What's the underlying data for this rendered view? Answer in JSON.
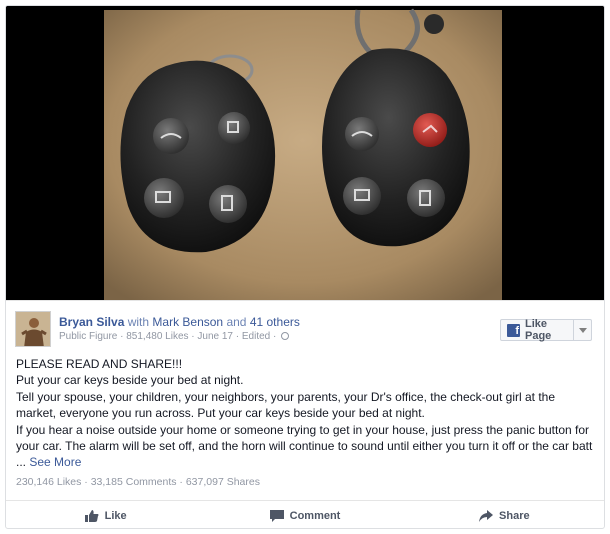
{
  "post": {
    "author": "Bryan Silva",
    "with_text": "with",
    "tagged": "Mark Benson",
    "and_text": "and",
    "others": "41 others",
    "meta": "Public Figure · 851,480 Likes · June 17 · Edited ·",
    "like_page_label": "Like Page",
    "lines": [
      "PLEASE READ AND SHARE!!!",
      "Put your car keys beside your bed at night.",
      "Tell your spouse, your children, your neighbors, your parents, your Dr's office, the check-out girl at the",
      "market, everyone you run across. Put your car keys beside your bed at night.",
      "If you hear a noise outside your home or someone trying to get in your house, just press the panic button for",
      "your car. The alarm will be set off, and the horn will continue to sound until either you turn it off or the car batt"
    ],
    "ellipsis": "...",
    "see_more": "See More",
    "stats": "230,146 Likes · 33,185 Comments · 637,097 Shares"
  },
  "actions": {
    "like": "Like",
    "comment": "Comment",
    "share": "Share"
  },
  "icons": {
    "photo": "car-key-fobs-photo",
    "like": "thumbs-up-icon",
    "comment": "comment-icon",
    "share": "share-arrow-icon"
  },
  "colors": {
    "link": "#3b5998",
    "muted": "#9197a3",
    "text": "#141823",
    "panic_button": "#c0282a"
  }
}
